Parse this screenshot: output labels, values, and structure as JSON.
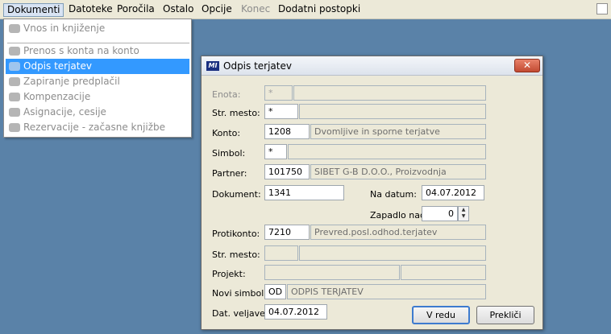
{
  "menubar": {
    "items": [
      "Dokumenti",
      "Datoteke",
      "Poročila",
      "Ostalo",
      "Opcije",
      "Konec",
      "Dodatni postopki"
    ]
  },
  "dropdown": {
    "items": [
      "Vnos in knjiženje",
      "Prenos s konta na konto",
      "Odpis terjatev",
      "Zapiranje predplačil",
      "Kompenzacije",
      "Asignacije, cesije",
      "Rezervacije - začasne knjižbe"
    ]
  },
  "dialog": {
    "icon_text": "MI",
    "title": "Odpis terjatev",
    "close_glyph": "✕",
    "labels": {
      "enota": "Enota:",
      "str_mesto": "Str. mesto:",
      "konto": "Konto:",
      "simbol": "Simbol:",
      "partner": "Partner:",
      "dokument": "Dokument:",
      "na_datum": "Na datum:",
      "zapadlo_nad": "Zapadlo nad:",
      "protikonto": "Protikonto:",
      "str_mesto2": "Str. mesto:",
      "projekt": "Projekt:",
      "novi_simbol": "Novi simbol:",
      "dat_veljave": "Dat. veljave:"
    },
    "values": {
      "enota_code": "*",
      "enota_name": "",
      "str_mesto_code": "*",
      "str_mesto_name": "",
      "konto_code": "1208",
      "konto_name": "Dvomljive in sporne terjatve",
      "simbol_code": "*",
      "simbol_name": "",
      "partner_code": "101750",
      "partner_name": "SIBET G-B D.O.O., Proizvodnja",
      "dokument": "1341",
      "na_datum": "04.07.2012",
      "zapadlo_nad": "0",
      "protikonto_code": "7210",
      "protikonto_name": "Prevred.posl.odhod.terjatev",
      "str_mesto2_code": "",
      "str_mesto2_name": "",
      "projekt_code": "",
      "projekt_name": "",
      "novi_simbol_code": "OD",
      "novi_simbol_name": "ODPIS TERJATEV",
      "dat_veljave": "04.07.2012"
    },
    "buttons": {
      "ok": "V redu",
      "cancel": "Prekliči"
    }
  }
}
